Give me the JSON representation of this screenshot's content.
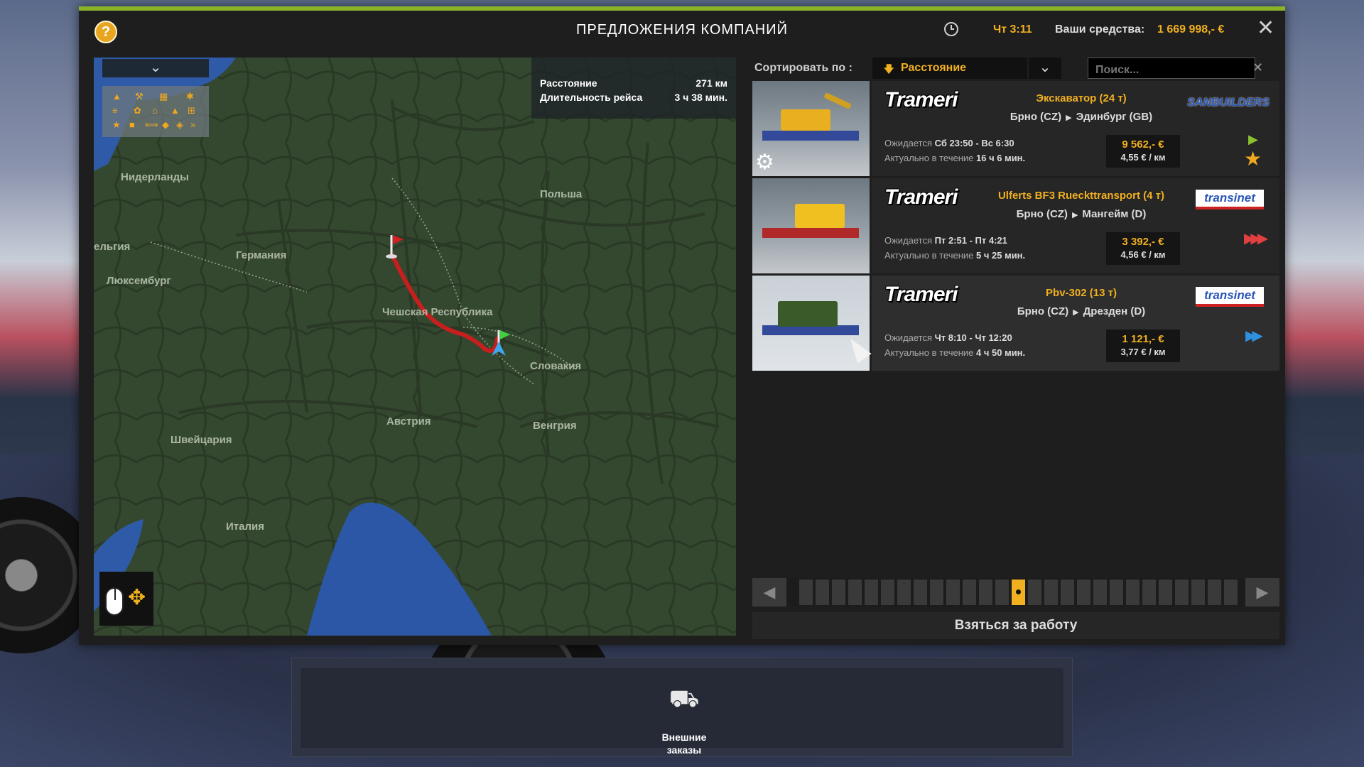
{
  "window": {
    "title": "ПРЕДЛОЖЕНИЯ КОМПАНИЙ",
    "help_label": "?",
    "time": "Чт 3:11",
    "funds_label": "Ваши средства:",
    "funds_value": "1 669 998,- €",
    "close_label": "✕"
  },
  "map": {
    "toggle_label": "⌄",
    "info": {
      "distance_label": "Расстояние",
      "distance_value": "271 км",
      "duration_label": "Длительность рейса",
      "duration_value": "3 ч 38 мин."
    },
    "labels": [
      "Нидерланды",
      "ельгия",
      "Люксембург",
      "Германия",
      "Польша",
      "Чешская Республика",
      "Словакия",
      "Австрия",
      "Венгрия",
      "Швейцария",
      "Италия"
    ]
  },
  "sort": {
    "label": "Сортировать по :",
    "selected": "Расстояние",
    "search_placeholder": "Поиск..."
  },
  "jobs": [
    {
      "company": "Trameri",
      "cargo": "Экскаватор (24 т)",
      "origin": "Брно (CZ)",
      "destination": "Эдинбург (GB)",
      "expected_label": "Ожидается",
      "expected": "Сб 23:50 - Вс 6:30",
      "valid_label": "Актуально в течение",
      "valid": "16 ч 6 мин.",
      "pay": "9 562,- €",
      "per_km": "4,55 € / км",
      "client": "SANBUILDERS",
      "badge": "normal"
    },
    {
      "company": "Trameri",
      "cargo": "Ulferts BF3 Rueckttransport (4 т)",
      "origin": "Брно (CZ)",
      "destination": "Мангейм (D)",
      "expected_label": "Ожидается",
      "expected": "Пт 2:51 - Пт 4:21",
      "valid_label": "Актуально в течение",
      "valid": "5 ч 25 мин.",
      "pay": "3 392,- €",
      "per_km": "4,56 € / км",
      "client": "transinet",
      "badge": "urgent"
    },
    {
      "company": "Trameri",
      "cargo": "Pbv-302 (13 т)",
      "origin": "Брно (CZ)",
      "destination": "Дрезден (D)",
      "expected_label": "Ожидается",
      "expected": "Чт 8:10 - Чт 12:20",
      "valid_label": "Актуально в течение",
      "valid": "4 ч 50 мин.",
      "pay": "1 121,- €",
      "per_km": "3,77 € / км",
      "client": "transinet",
      "badge": "fast"
    }
  ],
  "pager": {
    "total_pages": 27,
    "active_page": 14
  },
  "take_job_label": "Взяться за работу",
  "dock": {
    "external_orders_label": "Внешние\nзаказы"
  },
  "colors": {
    "accent": "#f0b020",
    "top_bar": "#8cb428",
    "route": "#c81e1e"
  },
  "icons": {
    "help": "question-icon",
    "clock": "clock-icon",
    "close": "close-icon",
    "sort_direction": "arrow-down-icon",
    "favorite": "star-icon",
    "urgent": "triple-chevron-icon",
    "fast": "double-chevron-icon",
    "mouse": "mouse-icon"
  }
}
